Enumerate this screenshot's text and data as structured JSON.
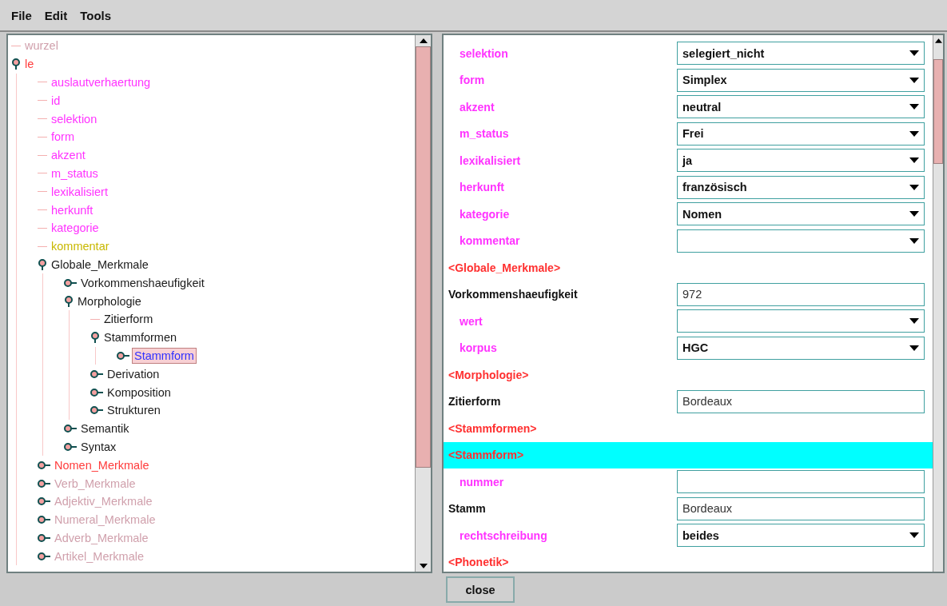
{
  "menu": [
    {
      "label": "File"
    },
    {
      "label": "Edit"
    },
    {
      "label": "Tools"
    }
  ],
  "tree": [
    {
      "label": "wurzel",
      "kind": "leaf",
      "selected": false,
      "color": "#d0a0ac"
    },
    {
      "label": "le",
      "kind": "branch",
      "expanded": true,
      "selected": false,
      "color": "#ff3b3b",
      "children": [
        {
          "label": "auslautverhaertung",
          "kind": "leaf",
          "selected": false,
          "color": "#ff33ff"
        },
        {
          "label": "id",
          "kind": "leaf",
          "selected": false,
          "color": "#ff33ff"
        },
        {
          "label": "selektion",
          "kind": "leaf",
          "selected": false,
          "color": "#ff33ff"
        },
        {
          "label": "form",
          "kind": "leaf",
          "selected": false,
          "color": "#ff33ff"
        },
        {
          "label": "akzent",
          "kind": "leaf",
          "selected": false,
          "color": "#ff33ff"
        },
        {
          "label": "m_status",
          "kind": "leaf",
          "selected": false,
          "color": "#ff33ff"
        },
        {
          "label": "lexikalisiert",
          "kind": "leaf",
          "selected": false,
          "color": "#ff33ff"
        },
        {
          "label": "herkunft",
          "kind": "leaf",
          "selected": false,
          "color": "#ff33ff"
        },
        {
          "label": "kategorie",
          "kind": "leaf",
          "selected": false,
          "color": "#ff33ff"
        },
        {
          "label": "kommentar",
          "kind": "leaf",
          "selected": false,
          "color": "#c8b800"
        },
        {
          "label": "Globale_Merkmale",
          "kind": "branch",
          "expanded": true,
          "selected": false,
          "color": "#1a1a1a",
          "children": [
            {
              "label": "Vorkommenshaeufigkeit",
              "kind": "branch",
              "expanded": false,
              "selected": false,
              "color": "#1a1a1a"
            },
            {
              "label": "Morphologie",
              "kind": "branch",
              "expanded": true,
              "selected": false,
              "color": "#1a1a1a",
              "children": [
                {
                  "label": "Zitierform",
                  "kind": "leaf",
                  "selected": false,
                  "color": "#1a1a1a"
                },
                {
                  "label": "Stammformen",
                  "kind": "branch",
                  "expanded": true,
                  "selected": false,
                  "color": "#1a1a1a",
                  "children": [
                    {
                      "label": "Stammform",
                      "kind": "branch",
                      "expanded": false,
                      "selected": true,
                      "color": "#3030ff"
                    }
                  ]
                },
                {
                  "label": "Derivation",
                  "kind": "branch",
                  "expanded": false,
                  "selected": false,
                  "color": "#1a1a1a"
                },
                {
                  "label": "Komposition",
                  "kind": "branch",
                  "expanded": false,
                  "selected": false,
                  "color": "#1a1a1a"
                },
                {
                  "label": "Strukturen",
                  "kind": "branch",
                  "expanded": false,
                  "selected": false,
                  "color": "#1a1a1a"
                }
              ]
            },
            {
              "label": "Semantik",
              "kind": "branch",
              "expanded": false,
              "selected": false,
              "color": "#1a1a1a"
            },
            {
              "label": "Syntax",
              "kind": "branch",
              "expanded": false,
              "selected": false,
              "color": "#1a1a1a"
            }
          ]
        },
        {
          "label": "Nomen_Merkmale",
          "kind": "branch",
          "expanded": false,
          "selected": false,
          "color": "#ff3b3b"
        },
        {
          "label": "Verb_Merkmale",
          "kind": "branch",
          "expanded": false,
          "selected": false,
          "color": "#d0a0ac"
        },
        {
          "label": "Adjektiv_Merkmale",
          "kind": "branch",
          "expanded": false,
          "selected": false,
          "color": "#d0a0ac"
        },
        {
          "label": "Numeral_Merkmale",
          "kind": "branch",
          "expanded": false,
          "selected": false,
          "color": "#d0a0ac"
        },
        {
          "label": "Adverb_Merkmale",
          "kind": "branch",
          "expanded": false,
          "selected": false,
          "color": "#d0a0ac"
        },
        {
          "label": "Artikel_Merkmale",
          "kind": "branch",
          "expanded": false,
          "selected": false,
          "color": "#d0a0ac"
        }
      ]
    }
  ],
  "rows": [
    {
      "kind": "attribute",
      "label": "selektion",
      "field": {
        "kind": "dropdown",
        "value": "selegiert_nicht"
      },
      "selected": false
    },
    {
      "kind": "attribute",
      "label": "form",
      "field": {
        "kind": "dropdown",
        "value": "Simplex"
      },
      "selected": false
    },
    {
      "kind": "attribute",
      "label": "akzent",
      "field": {
        "kind": "dropdown",
        "value": "neutral"
      },
      "selected": false
    },
    {
      "kind": "attribute",
      "label": "m_status",
      "field": {
        "kind": "dropdown",
        "value": "Frei"
      },
      "selected": false
    },
    {
      "kind": "attribute",
      "label": "lexikalisiert",
      "field": {
        "kind": "dropdown",
        "value": "ja"
      },
      "selected": false
    },
    {
      "kind": "attribute",
      "label": "herkunft",
      "field": {
        "kind": "dropdown",
        "value": "französisch"
      },
      "selected": false
    },
    {
      "kind": "attribute",
      "label": "kategorie",
      "field": {
        "kind": "dropdown",
        "value": "Nomen"
      },
      "selected": false
    },
    {
      "kind": "attribute",
      "label": "kommentar",
      "field": {
        "kind": "dropdown"
      },
      "selected": false
    },
    {
      "kind": "tag",
      "label": "<Globale_Merkmale>",
      "selected": false
    },
    {
      "kind": "element",
      "label": "Vorkommenshaeufigkeit",
      "field": {
        "kind": "textbox",
        "value": "972"
      },
      "selected": false
    },
    {
      "kind": "attribute",
      "label": "wert",
      "field": {
        "kind": "dropdown"
      },
      "selected": false
    },
    {
      "kind": "attribute",
      "label": "korpus",
      "field": {
        "kind": "dropdown",
        "value": "HGC"
      },
      "selected": false
    },
    {
      "kind": "tag",
      "label": "<Morphologie>",
      "selected": false
    },
    {
      "kind": "element",
      "label": "Zitierform",
      "field": {
        "kind": "textbox",
        "value": "Bordeaux"
      },
      "selected": false
    },
    {
      "kind": "tag",
      "label": "<Stammformen>",
      "selected": false
    },
    {
      "kind": "tag",
      "label": "<Stammform>",
      "selected": true
    },
    {
      "kind": "attribute",
      "label": "nummer",
      "field": {
        "kind": "textbox"
      },
      "selected": false
    },
    {
      "kind": "element",
      "label": "Stamm",
      "field": {
        "kind": "textbox",
        "value": "Bordeaux"
      },
      "selected": false
    },
    {
      "kind": "attribute",
      "label": "rechtschreibung",
      "field": {
        "kind": "dropdown",
        "value": "beides"
      },
      "selected": false
    },
    {
      "kind": "tag",
      "label": "<Phonetik>",
      "selected": false
    }
  ],
  "close_button": {
    "label": "close"
  }
}
